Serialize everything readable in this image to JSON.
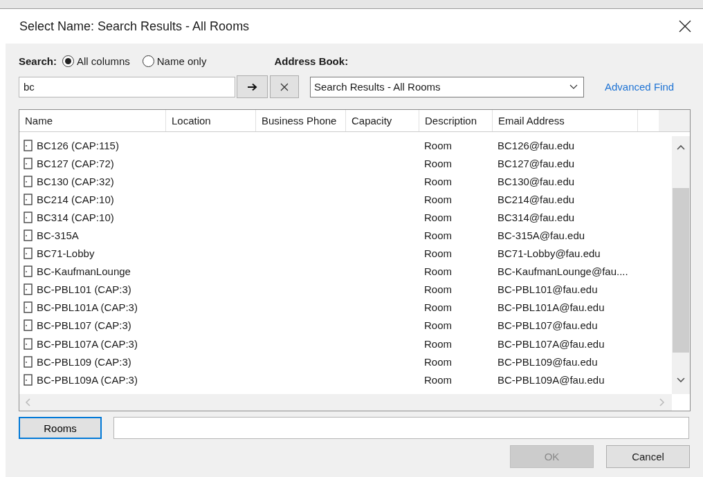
{
  "window": {
    "title": "Select Name: Search Results - All Rooms"
  },
  "search": {
    "label": "Search:",
    "options": [
      {
        "label": "All columns",
        "selected": true
      },
      {
        "label": "Name only",
        "selected": false
      }
    ],
    "value": "bc"
  },
  "address_book": {
    "label": "Address Book:",
    "value": "Search Results - All Rooms"
  },
  "advanced_find": "Advanced Find",
  "table": {
    "columns": [
      "Name",
      "Location",
      "Business Phone",
      "Capacity",
      "Description",
      "Email Address"
    ],
    "rows": [
      {
        "name": "BC126 (CAP:115)",
        "description": "Room",
        "email": "BC126@fau.edu"
      },
      {
        "name": "BC127 (CAP:72)",
        "description": "Room",
        "email": "BC127@fau.edu"
      },
      {
        "name": "BC130 (CAP:32)",
        "description": "Room",
        "email": "BC130@fau.edu"
      },
      {
        "name": "BC214 (CAP:10)",
        "description": "Room",
        "email": "BC214@fau.edu"
      },
      {
        "name": "BC314 (CAP:10)",
        "description": "Room",
        "email": "BC314@fau.edu"
      },
      {
        "name": "BC-315A",
        "description": "Room",
        "email": "BC-315A@fau.edu"
      },
      {
        "name": "BC71-Lobby",
        "description": "Room",
        "email": "BC71-Lobby@fau.edu"
      },
      {
        "name": "BC-KaufmanLounge",
        "description": "Room",
        "email": "BC-KaufmanLounge@fau...."
      },
      {
        "name": "BC-PBL101 (CAP:3)",
        "description": "Room",
        "email": "BC-PBL101@fau.edu"
      },
      {
        "name": "BC-PBL101A (CAP:3)",
        "description": "Room",
        "email": "BC-PBL101A@fau.edu"
      },
      {
        "name": "BC-PBL107 (CAP:3)",
        "description": "Room",
        "email": "BC-PBL107@fau.edu"
      },
      {
        "name": "BC-PBL107A (CAP:3)",
        "description": "Room",
        "email": "BC-PBL107A@fau.edu"
      },
      {
        "name": "BC-PBL109 (CAP:3)",
        "description": "Room",
        "email": "BC-PBL109@fau.edu"
      },
      {
        "name": "BC-PBL109A (CAP:3)",
        "description": "Room",
        "email": "BC-PBL109A@fau.edu"
      }
    ]
  },
  "rooms_button": "Rooms",
  "buttons": [
    {
      "label": "OK",
      "disabled": true
    },
    {
      "label": "Cancel",
      "disabled": false
    }
  ]
}
